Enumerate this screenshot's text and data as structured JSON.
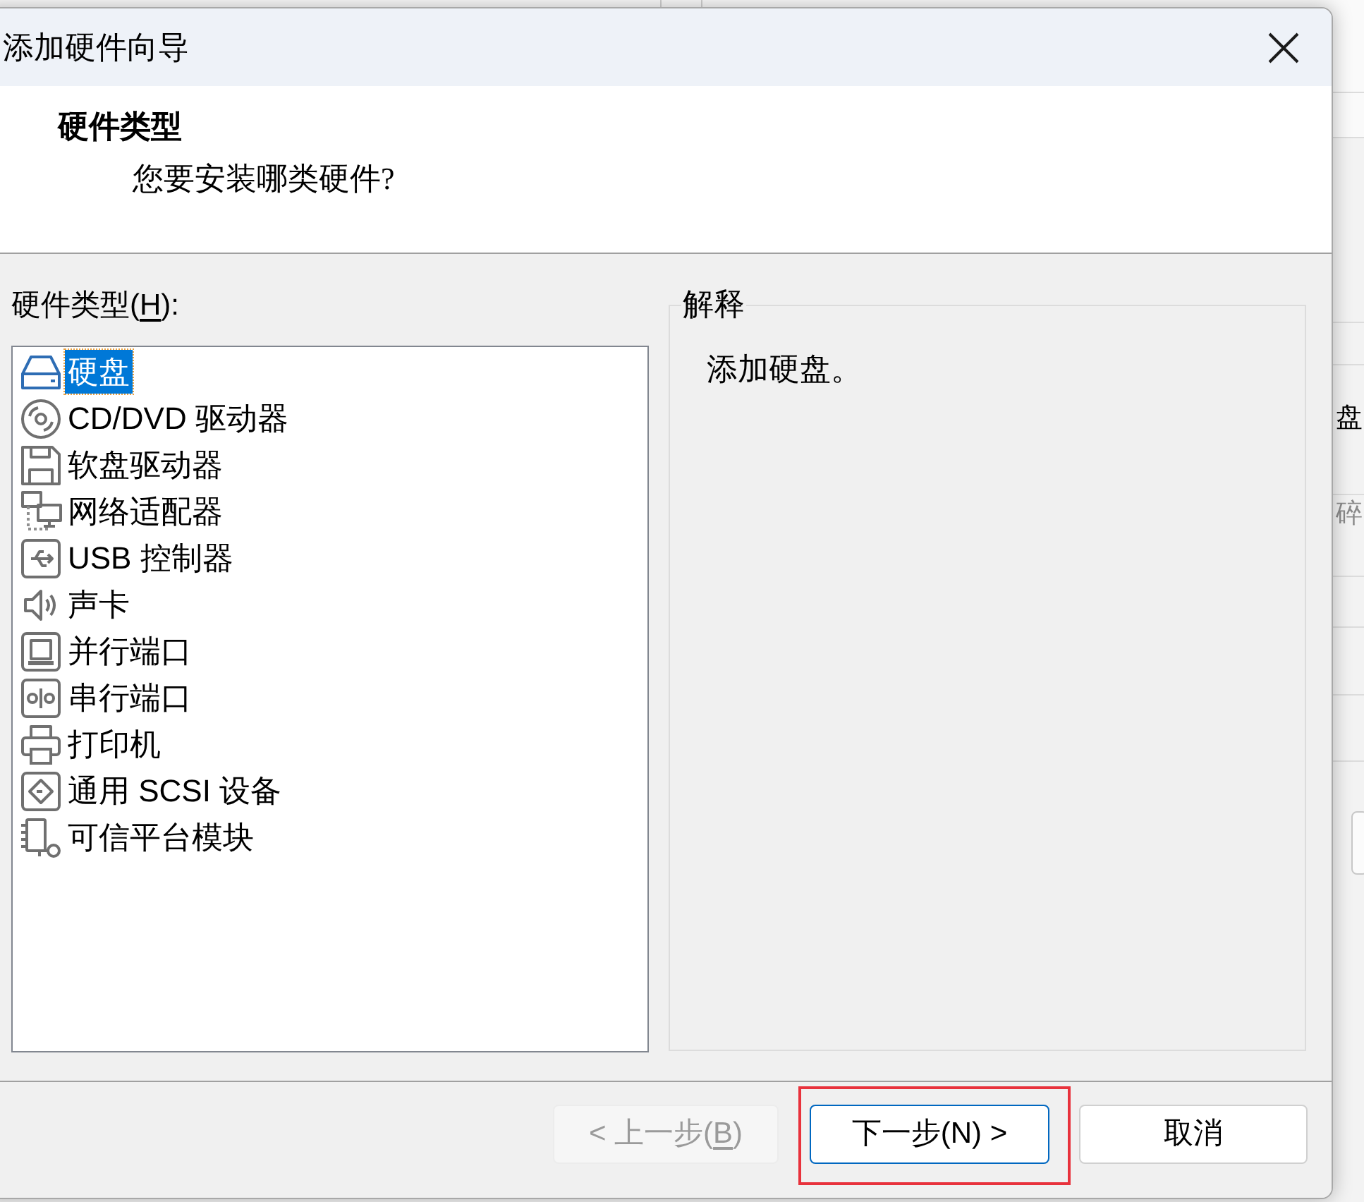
{
  "window": {
    "title": "添加硬件向导"
  },
  "header": {
    "title": "硬件类型",
    "subtitle": "您要安装哪类硬件?"
  },
  "hardware_list": {
    "label": {
      "before": "硬件类型(",
      "access_key": "H",
      "after": "):"
    },
    "items": [
      {
        "kind": "disk",
        "label": "硬盘",
        "selected": true
      },
      {
        "kind": "optical",
        "label": "CD/DVD 驱动器",
        "selected": false
      },
      {
        "kind": "floppy",
        "label": "软盘驱动器",
        "selected": false
      },
      {
        "kind": "network",
        "label": "网络适配器",
        "selected": false
      },
      {
        "kind": "usb",
        "label": "USB 控制器",
        "selected": false
      },
      {
        "kind": "sound",
        "label": "声卡",
        "selected": false
      },
      {
        "kind": "parallel",
        "label": "并行端口",
        "selected": false
      },
      {
        "kind": "serial",
        "label": "串行端口",
        "selected": false
      },
      {
        "kind": "printer",
        "label": "打印机",
        "selected": false
      },
      {
        "kind": "scsi",
        "label": "通用 SCSI 设备",
        "selected": false
      },
      {
        "kind": "tpm",
        "label": "可信平台模块",
        "selected": false
      }
    ]
  },
  "description": {
    "title": "解释",
    "text": "添加硬盘。"
  },
  "buttons": [
    {
      "before": "< 上一步(",
      "access_key": "B",
      "after": ")",
      "disabled": true,
      "default": false,
      "highlighted": false
    },
    {
      "label": "下一步(N) >",
      "disabled": false,
      "default": true,
      "highlighted": true
    },
    {
      "label": "取消",
      "disabled": false,
      "default": false,
      "highlighted": false
    }
  ],
  "background_window": {
    "texts": [
      {
        "text": "盘",
        "disabled": false
      },
      {
        "text": "碎",
        "disabled": true
      }
    ]
  }
}
